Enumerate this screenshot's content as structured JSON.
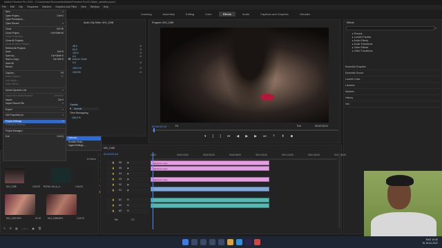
{
  "window": {
    "title": "Adobe Premiere Pro 2022 - C:\\Users\\user\\Documents\\Adobe\\Premiere Pro\\22.0\\fake_sahalka.prproj *"
  },
  "menubar": [
    "File",
    "Edit",
    "Clip",
    "Sequence",
    "Markers",
    "Graphics and Titles",
    "View",
    "Window",
    "Help"
  ],
  "workspaces": [
    {
      "label": "Learning",
      "active": false
    },
    {
      "label": "Assembly",
      "active": false
    },
    {
      "label": "Editing",
      "active": false
    },
    {
      "label": "Color",
      "active": false
    },
    {
      "label": "Effects",
      "active": true
    },
    {
      "label": "Audio",
      "active": false
    },
    {
      "label": "Captions and Graphics",
      "active": false
    },
    {
      "label": "Libraries",
      "active": false
    }
  ],
  "file_menu": [
    {
      "label": "New",
      "shortcut": ">",
      "dim": false
    },
    {
      "label": "Open Project...",
      "shortcut": "Ctrl+O",
      "dim": false
    },
    {
      "label": "Open Production...",
      "shortcut": "",
      "dim": false
    },
    {
      "label": "Open Recent",
      "shortcut": ">",
      "dim": false
    },
    {
      "sep": true
    },
    {
      "label": "Close",
      "shortcut": "Ctrl+W",
      "dim": false
    },
    {
      "label": "Close Project",
      "shortcut": "Ctrl+Shift+W",
      "dim": false
    },
    {
      "label": "Close Production",
      "shortcut": "",
      "dim": true
    },
    {
      "label": "Close All Projects",
      "shortcut": "",
      "dim": false
    },
    {
      "label": "Close All Other Projects",
      "shortcut": "",
      "dim": true
    },
    {
      "label": "Refresh All Projects",
      "shortcut": "",
      "dim": false
    },
    {
      "label": "Save",
      "shortcut": "Ctrl+S",
      "dim": false
    },
    {
      "label": "Save As...",
      "shortcut": "Ctrl+Shift+S",
      "dim": false
    },
    {
      "label": "Save a Copy...",
      "shortcut": "Ctrl+Alt+S",
      "dim": false
    },
    {
      "label": "Save All",
      "shortcut": "",
      "dim": false
    },
    {
      "label": "Revert",
      "shortcut": "",
      "dim": false
    },
    {
      "sep": true
    },
    {
      "label": "Capture...",
      "shortcut": "F5",
      "dim": false
    },
    {
      "label": "Batch Capture...",
      "shortcut": "F6",
      "dim": true
    },
    {
      "label": "Link Media...",
      "shortcut": "",
      "dim": true
    },
    {
      "label": "Make Offline...",
      "shortcut": "",
      "dim": true
    },
    {
      "sep": true
    },
    {
      "label": "Adobe Dynamic Link",
      "shortcut": ">",
      "dim": false
    },
    {
      "sep": true
    },
    {
      "label": "Import from Media Browser",
      "shortcut": "Ctrl+Alt+I",
      "dim": true
    },
    {
      "label": "Import...",
      "shortcut": "Ctrl+I",
      "dim": false
    },
    {
      "label": "Import Recent File",
      "shortcut": ">",
      "dim": false
    },
    {
      "sep": true
    },
    {
      "label": "Export",
      "shortcut": ">",
      "dim": false
    },
    {
      "sep": true
    },
    {
      "label": "Get Properties for",
      "shortcut": ">",
      "dim": false
    },
    {
      "sep": true
    },
    {
      "label": "Project Settings",
      "shortcut": ">",
      "dim": false,
      "highlight": true
    },
    {
      "label": "Production Settings",
      "shortcut": "",
      "dim": true
    },
    {
      "sep": true
    },
    {
      "label": "Project Manager...",
      "shortcut": "",
      "dim": false
    },
    {
      "sep": true
    },
    {
      "label": "Exit",
      "shortcut": "Ctrl+Q",
      "dim": false
    }
  ],
  "sub_menu": [
    {
      "label": "General...",
      "highlight": true
    },
    {
      "label": "Scratch Disks...",
      "highlight": false
    },
    {
      "label": "Ingest Settings...",
      "highlight": false
    }
  ],
  "source_panel": {
    "tab": "Audio Clip Mixer: MVI_2188",
    "rows": [
      "Opacity",
      "Blend Mode",
      "Time Remapping"
    ],
    "blend_value": "Normal",
    "opacity_value": "100.0 %",
    "values": [
      "48.0",
      "64.0",
      "100.0",
      "0.0",
      "0.0",
      "100.0 %",
      "100.0%"
    ],
    "checkbox_label": "Uniform Scale"
  },
  "program": {
    "tab": "Program: MVI_2188",
    "timecode": "00:00:00:16",
    "fit": "Fit",
    "quality": "Full",
    "duration": "00:02:33:21"
  },
  "effects_panel": {
    "tab": "Effects",
    "tree": [
      {
        "label": "Presets",
        "sub": true
      },
      {
        "label": "Lumetri Presets",
        "sub": true
      },
      {
        "label": "Audio Effects",
        "sub": true
      },
      {
        "label": "Audio Transitions",
        "sub": true
      },
      {
        "label": "Video Effects",
        "sub": true
      },
      {
        "label": "Video Transitions",
        "sub": true
      }
    ],
    "sections": [
      "Essential Graphics",
      "Essential Sound",
      "Lumetri Color",
      "Libraries",
      "Markers",
      "History",
      "Info"
    ]
  },
  "project": {
    "tab": "Project: fake_sahalka",
    "items_count": "12 Items",
    "clips": [
      {
        "name": "MVI_2188",
        "duration": "2:34:03"
      },
      {
        "name": "ROYAL VILLA_0...",
        "duration": "1:34:20"
      },
      {
        "name": "MVI_2187.MP4",
        "duration": "47:10"
      },
      {
        "name": "MVI_2188.MP4",
        "duration": "1:13:19"
      }
    ]
  },
  "timeline": {
    "tab": "MVI_2188",
    "timecode": "00:00:00:16",
    "ruler": [
      "00:00",
      "00:00:15:00",
      "00:00:30:00",
      "00:00:45:00",
      "00:01:00:00",
      "00:01:15:00",
      "00:01:30:00",
      "00:01:45:00"
    ],
    "video_tracks": [
      "V6",
      "V5",
      "V4",
      "V3",
      "V2",
      "V1"
    ],
    "audio_tracks": [
      "A1",
      "A2",
      "A3"
    ],
    "mix_label": "Mix",
    "mix_value": "0.0",
    "clip_labels": [
      "Adjustment Layer",
      "Adjustment Layer",
      "Adjustment Layer"
    ]
  },
  "taskbar": {
    "time": "10:30",
    "date": "15-04-2022",
    "lang": "ENG",
    "region": "IN"
  },
  "colors": {
    "accent": "#2d6ad4",
    "clip_pink": "#e59ee2",
    "clip_teal": "#56b9b1",
    "clip_blue": "#7fa8d9",
    "playhead": "#4f8ef7"
  }
}
